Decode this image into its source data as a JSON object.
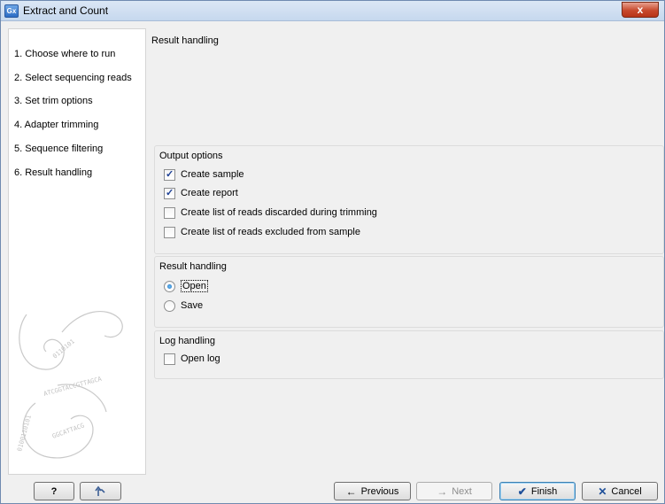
{
  "window": {
    "title": "Extract and Count",
    "app_icon_text": "Gx",
    "close_label": "x"
  },
  "steps": [
    {
      "label": "1.  Choose where to run"
    },
    {
      "label": "2.  Select sequencing reads"
    },
    {
      "label": "3.  Set trim options"
    },
    {
      "label": "4.  Adapter trimming"
    },
    {
      "label": "5.  Sequence filtering"
    },
    {
      "label": "6.  Result handling"
    }
  ],
  "content": {
    "title": "Result handling"
  },
  "output_options": {
    "title": "Output options",
    "items": [
      {
        "label": "Create sample",
        "checked": true
      },
      {
        "label": "Create report",
        "checked": true
      },
      {
        "label": "Create list of reads discarded during trimming",
        "checked": false
      },
      {
        "label": "Create list of reads excluded from sample",
        "checked": false
      }
    ]
  },
  "result_handling": {
    "title": "Result handling",
    "options": [
      {
        "label": "Open",
        "selected": true
      },
      {
        "label": "Save",
        "selected": false
      }
    ]
  },
  "log_handling": {
    "title": "Log handling",
    "items": [
      {
        "label": "Open log",
        "checked": false
      }
    ]
  },
  "buttons": {
    "help": "?",
    "reset_icon": "undo-arrow-icon",
    "previous": "Previous",
    "next": "Next",
    "finish": "Finish",
    "cancel": "Cancel"
  },
  "colors": {
    "accent": "#1e6fc1",
    "close": "#c7492d"
  }
}
